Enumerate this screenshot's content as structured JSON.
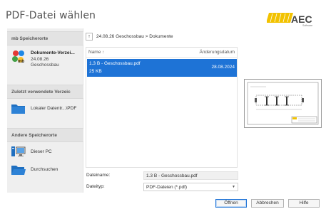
{
  "dialog": {
    "title": "PDF-Datei wählen",
    "logo": {
      "text_mb": "mb",
      "text_aec": "AEC",
      "tagline": "Software",
      "accent": "#f2c200"
    }
  },
  "sidebar": {
    "sections": [
      {
        "header": "mb Speicherorte",
        "items": [
          {
            "icon": "mb-project-icon",
            "line1": "Dokumente-Verzei...",
            "line2": "24.08.26",
            "line3": "Geschossbau"
          }
        ]
      },
      {
        "header": "Zuletzt verwendete Verzeic",
        "items": [
          {
            "icon": "folder-icon",
            "label": "Lokaler Datentr...\\PDF"
          }
        ]
      },
      {
        "header": "Andere Speicherorte",
        "items": [
          {
            "icon": "computer-icon",
            "label": "Dieser PC"
          },
          {
            "icon": "folder-icon",
            "label": "Durchsuchen"
          }
        ]
      }
    ]
  },
  "browser": {
    "up_label": "↑",
    "breadcrumb": "24.08.26 Geschossbau > Dokumente",
    "columns": {
      "name": "Name ↑",
      "date": "Änderungsdatum"
    },
    "files": [
      {
        "name": "1.3 B - Geschossbau.pdf",
        "size": "25 KB",
        "date": "28.08.2024",
        "selected": true
      }
    ]
  },
  "fields": {
    "filename_label": "Dateiname:",
    "filename_value": "1.3 B - Geschossbau.pdf",
    "filetype_label": "Dateityp:",
    "filetype_value": "PDF-Dateien (*.pdf)"
  },
  "buttons": {
    "open": "Öffnen",
    "cancel": "Abbrechen",
    "help": "Hilfe"
  },
  "colors": {
    "selection": "#1e73d6",
    "folder": "#1f6fc0",
    "sidebar_bg": "#efefef"
  }
}
